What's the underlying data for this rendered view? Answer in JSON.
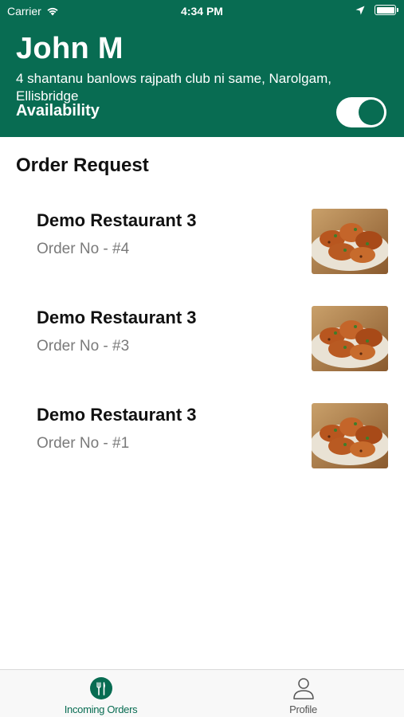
{
  "status_bar": {
    "carrier": "Carrier",
    "time": "4:34 PM"
  },
  "header": {
    "name": "John M",
    "address": "4 shantanu banlows rajpath club ni same, Narolgam, Ellisbridge",
    "availability_label": "Availability",
    "availability_on": true,
    "accent_color": "#086c52"
  },
  "main": {
    "section_title": "Order Request",
    "orders": [
      {
        "restaurant": "Demo Restaurant 3",
        "order_no": "Order No - #4",
        "thumb_icon": "grilled-chicken-image"
      },
      {
        "restaurant": "Demo Restaurant 3",
        "order_no": "Order No - #3",
        "thumb_icon": "grilled-chicken-image"
      },
      {
        "restaurant": "Demo Restaurant 3",
        "order_no": "Order No - #1",
        "thumb_icon": "grilled-chicken-image"
      }
    ]
  },
  "tab_bar": {
    "tabs": [
      {
        "label": "Incoming Orders",
        "icon": "fork-knife-icon",
        "active": true
      },
      {
        "label": "Profile",
        "icon": "person-icon",
        "active": false
      }
    ]
  }
}
